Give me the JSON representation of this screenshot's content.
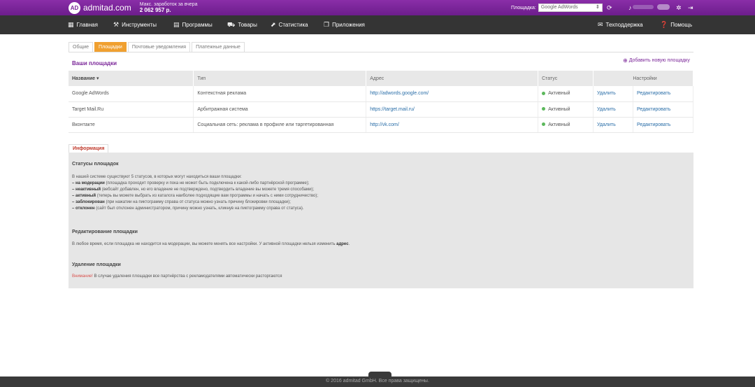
{
  "topbar": {
    "logo_mark": "AD",
    "logo_text": "admitad.com",
    "earnings_label": "Макс. заработок за вчера",
    "earnings_value": "2 062 957 р.",
    "platform_label": "Площадка:",
    "platform_value": "Google AdWords",
    "user_badge": "Ad"
  },
  "nav": {
    "items": [
      {
        "label": "Главная",
        "icon": "grid-icon"
      },
      {
        "label": "Инструменты",
        "icon": "tools-icon"
      },
      {
        "label": "Программы",
        "icon": "folder-icon"
      },
      {
        "label": "Товары",
        "icon": "cart-icon"
      },
      {
        "label": "Статистика",
        "icon": "chart-icon"
      },
      {
        "label": "Приложения",
        "icon": "apps-icon"
      }
    ],
    "support": "Техподдержка",
    "help": "Помощь"
  },
  "tabs": [
    "Общие",
    "Площадки",
    "Почтовые уведомления",
    "Платежные данные"
  ],
  "section": {
    "title": "Ваши площадки",
    "add_link": "Добавить новую площадку"
  },
  "table": {
    "headers": [
      "Название",
      "Тип",
      "Адрес",
      "Статус",
      "Настройки"
    ],
    "rows": [
      {
        "name": "Google AdWords",
        "type": "Контекстная реклама",
        "url": "http://adwords.google.com/",
        "status": "Активный",
        "delete": "Удалить",
        "edit": "Редактировать"
      },
      {
        "name": "Target Mail.Ru",
        "type": "Арбитражная система",
        "url": "https://target.mail.ru/",
        "status": "Активный",
        "delete": "Удалить",
        "edit": "Редактировать"
      },
      {
        "name": "Вконтакте",
        "type": "Социальная сеть: реклама в профиле или таргетированная",
        "url": "http://vk.com/",
        "status": "Активный",
        "delete": "Удалить",
        "edit": "Редактировать"
      }
    ]
  },
  "info": {
    "tab": "Информация",
    "statuses_title": "Статусы площадок",
    "statuses_intro": "В нашей системе существуют 5 статусов, в которых могут находиться ваши площадки:",
    "status_lines": [
      {
        "term": "– на модерации",
        "text": " (площадка проходит проверку и пока не может быть подключена к какой-либо партнёрской программе);"
      },
      {
        "term": "– неактивный",
        "text": " (вебсайт добавлен, но его владение не подтверждено, подтвердить владение вы можете тремя способами);"
      },
      {
        "term": "– активный",
        "text": " (теперь вы можете выбрать из каталога наиболее подходящие вам программы и начать с ними сотрудничество);"
      },
      {
        "term": "– заблокирован",
        "text": " (при нажатии на пиктограмму справа от статуса можно узнать причину блокировки площадки);"
      },
      {
        "term": "– отклонен",
        "text": " (сайт был отклонен администратором, причину можно узнать, кликнув на пиктограмму справа от статуса)."
      }
    ],
    "edit_title": "Редактирование площадки",
    "edit_text": "В любое время, если площадка не находится на модерации, вы можете менять все настройки. У активной площадки нельзя изменить ",
    "edit_bold": "адрес",
    "delete_title": "Удаление площадки",
    "delete_warn": "Внимание!",
    "delete_text": " В случае удаления площадки все партнёрства с рекламодателями автоматически расторгаются"
  },
  "footer": "© 2016 admitad GmbH. Все права защищены."
}
